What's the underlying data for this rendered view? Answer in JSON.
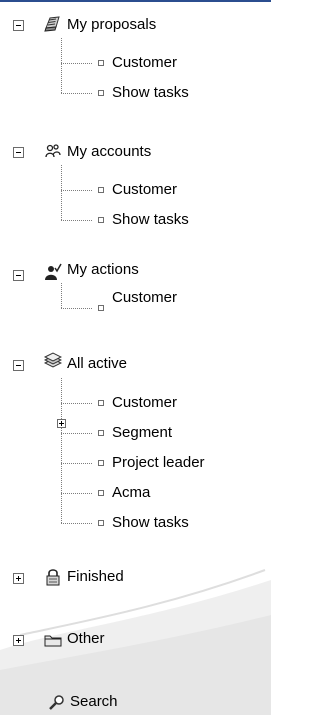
{
  "tree": {
    "proposals": {
      "label": "My proposals",
      "icon": "proposal-icon",
      "expanded": true,
      "children": [
        "Customer",
        "Show tasks"
      ]
    },
    "accounts": {
      "label": "My accounts",
      "icon": "accounts-icon",
      "expanded": true,
      "children": [
        "Customer",
        "Show tasks"
      ]
    },
    "actions": {
      "label": "My actions",
      "icon": "actions-icon",
      "expanded": true,
      "children": [
        "Customer"
      ]
    },
    "all_active": {
      "label": "All active",
      "icon": "books-icon",
      "expanded": true,
      "children": [
        "Customer",
        "Segment",
        "Project leader",
        "Acma",
        "Show tasks"
      ]
    },
    "finished": {
      "label": "Finished",
      "icon": "lock-icon",
      "expanded": false
    },
    "other": {
      "label": "Other",
      "icon": "folder-icon",
      "expanded": false
    },
    "search": {
      "label": "Search",
      "icon": "magnifier-icon"
    }
  },
  "colors": {
    "tree_line": "#7d7d7d",
    "top_border": "#2b4e8f"
  }
}
